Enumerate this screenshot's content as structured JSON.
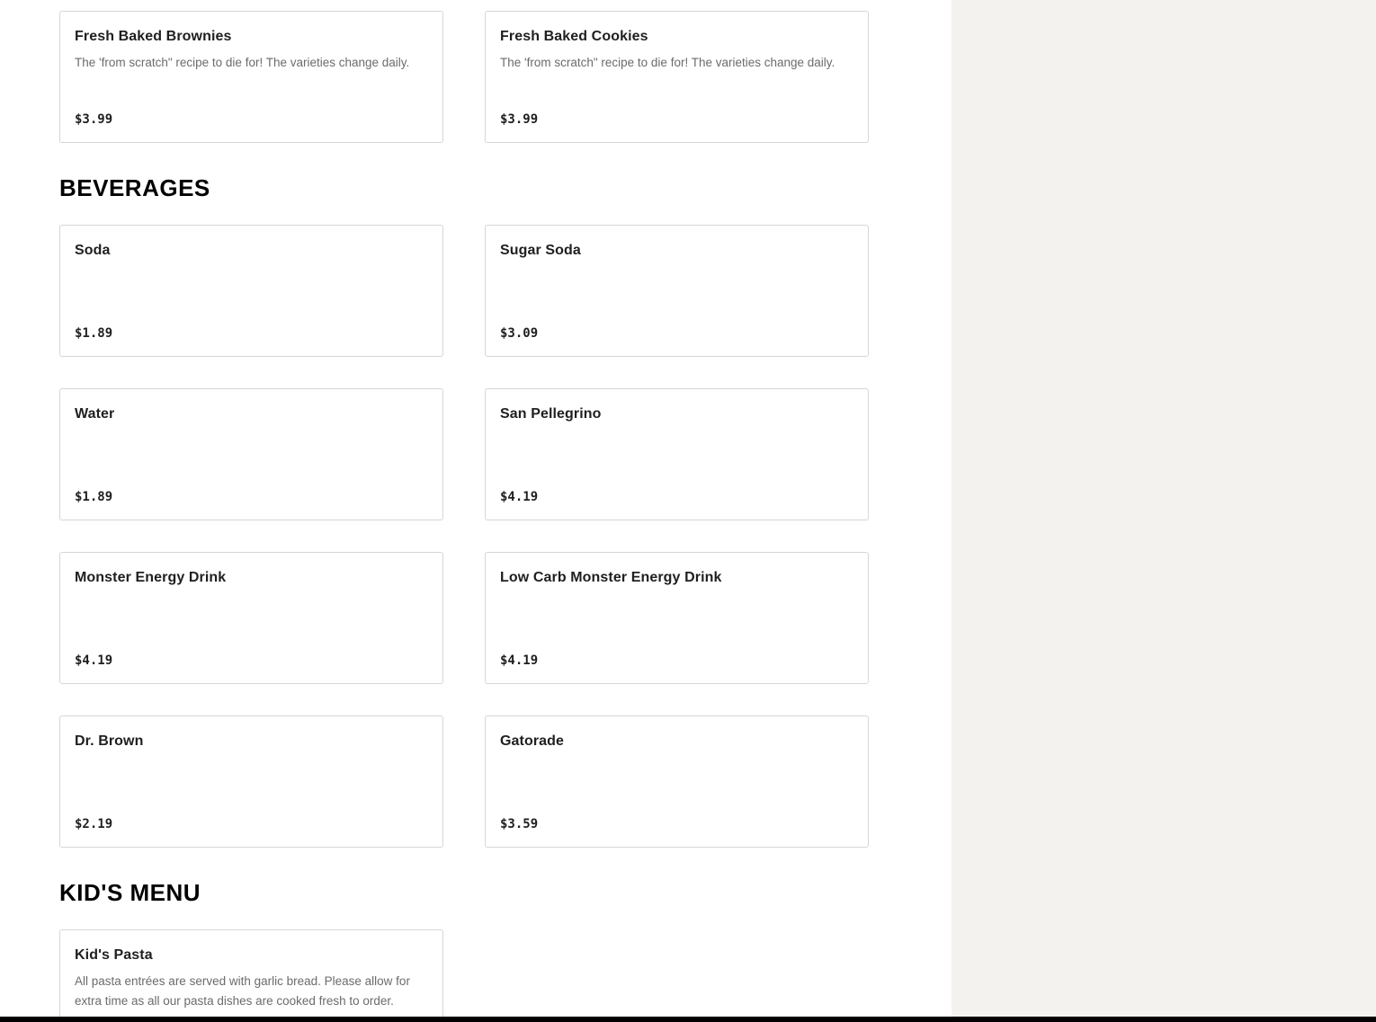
{
  "desserts": {
    "items": [
      {
        "name": "Fresh Baked Brownies",
        "description": "The 'from scratch\" recipe to die for! The varieties change daily.",
        "price": "$3.99"
      },
      {
        "name": "Fresh Baked Cookies",
        "description": "The 'from scratch\" recipe to die for! The varieties change daily.",
        "price": "$3.99"
      }
    ]
  },
  "beverages": {
    "title": "BEVERAGES",
    "items": [
      {
        "name": "Soda",
        "price": "$1.89"
      },
      {
        "name": "Sugar Soda",
        "price": "$3.09"
      },
      {
        "name": "Water",
        "price": "$1.89"
      },
      {
        "name": "San Pellegrino",
        "price": "$4.19"
      },
      {
        "name": "Monster Energy Drink",
        "price": "$4.19"
      },
      {
        "name": "Low Carb Monster Energy Drink",
        "price": "$4.19"
      },
      {
        "name": "Dr. Brown",
        "price": "$2.19"
      },
      {
        "name": "Gatorade",
        "price": "$3.59"
      }
    ]
  },
  "kids_menu": {
    "title": "KID'S MENU",
    "items": [
      {
        "name": "Kid's Pasta",
        "description": "All pasta entrées are served with garlic bread. Please allow for extra time as all our pasta dishes are cooked fresh to order."
      }
    ]
  }
}
